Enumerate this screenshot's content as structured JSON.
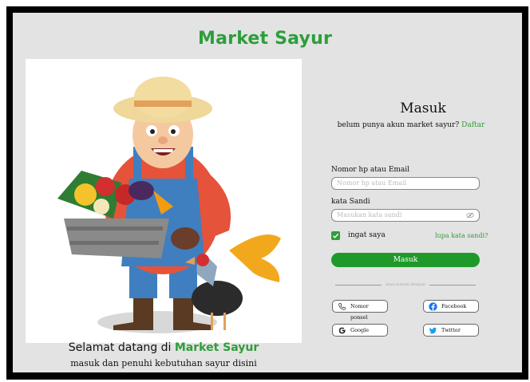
{
  "brand": {
    "title": "Market Sayur"
  },
  "welcome": {
    "prefix": "Selamat datang di ",
    "highlight": "Market Sayur",
    "subtitle": "masuk dan penuhi kebutuhan sayur disini"
  },
  "login": {
    "title": "Masuk",
    "no_account_text": "belum punya akun market sayur?",
    "register_link": "Daftar",
    "phone_label": "Nomor hp atau  Email",
    "phone_placeholder": "Nomor hp atau  Email",
    "password_label": "kata Sandi",
    "password_placeholder": "Masukan kata sandi",
    "remember_label": "ingat saya",
    "forgot_link": "lupa kata sandi?",
    "submit_label": "Masuk",
    "divider_text": "atau masuk dengan"
  },
  "social": {
    "phone": "Nomor ponsel",
    "facebook": "Facebook",
    "google": "Google",
    "twitter": "Twitter"
  },
  "colors": {
    "brand_green": "#2e9e3a",
    "button_green": "#1f9a2a",
    "background": "#e3e3e3"
  }
}
